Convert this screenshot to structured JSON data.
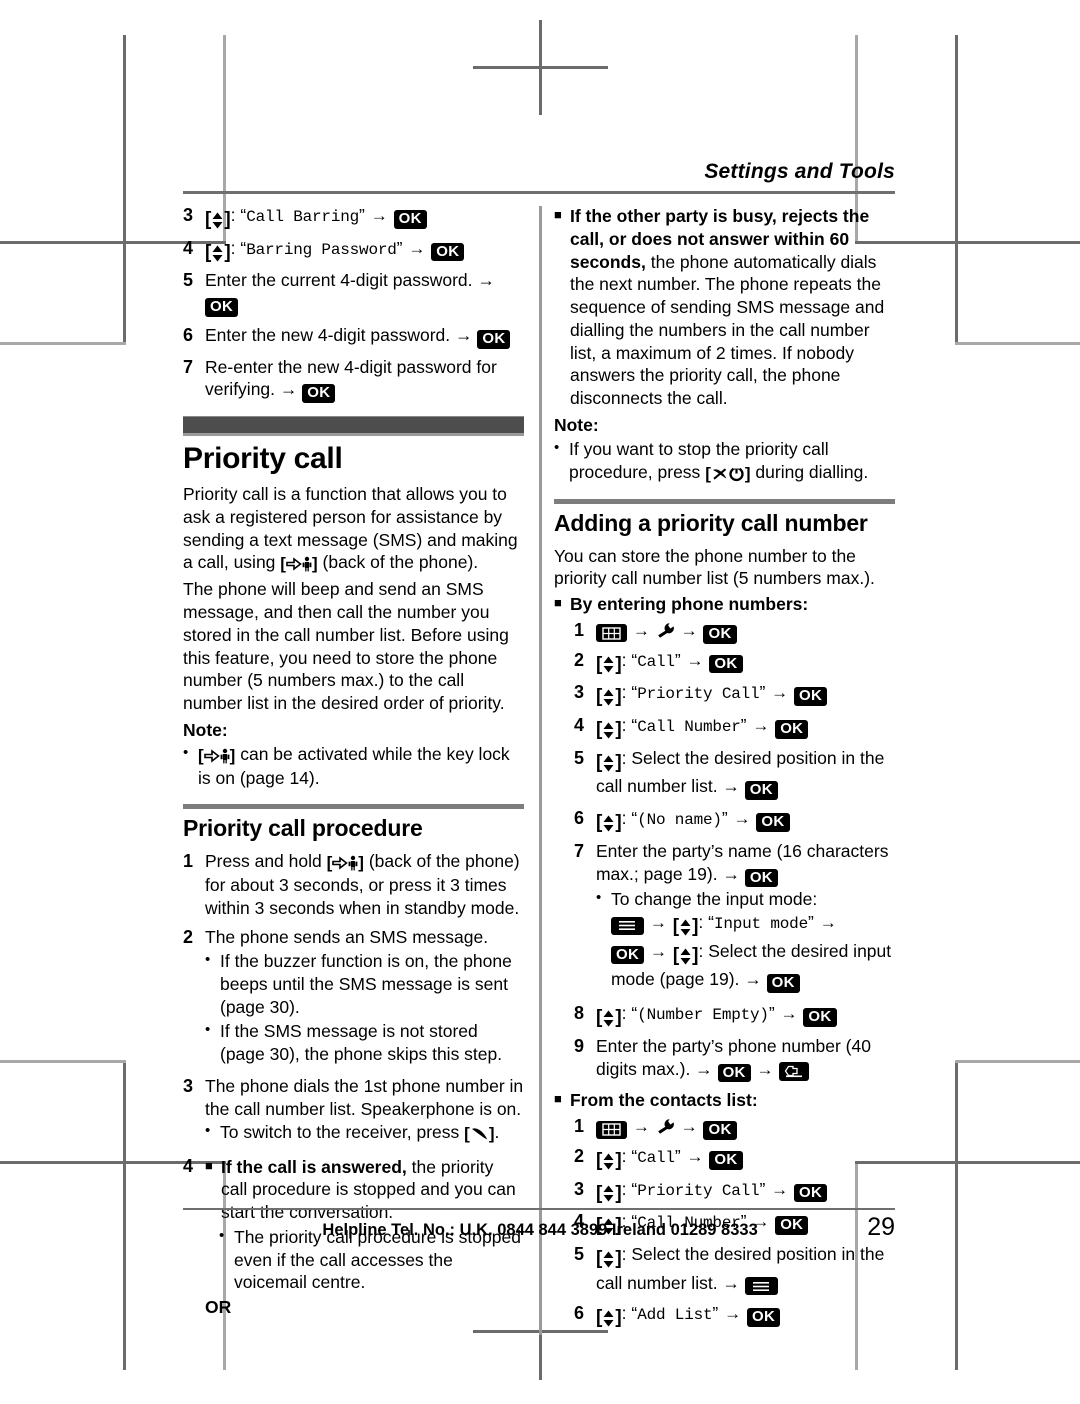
{
  "running_head": "Settings and Tools",
  "left_column": {
    "barring_steps": [
      {
        "num": "3",
        "kind": "nav_mono",
        "quoted": "Call Barring",
        "tail_ok": true
      },
      {
        "num": "4",
        "kind": "nav_mono",
        "quoted": "Barring Password",
        "tail_ok": true
      },
      {
        "num": "5",
        "kind": "text",
        "text": "Enter the current 4-digit password. → OK"
      },
      {
        "num": "6",
        "kind": "text",
        "text": "Enter the new 4-digit password. → OK"
      },
      {
        "num": "7",
        "kind": "text",
        "text": "Re-enter the new 4-digit password for verifying. → OK"
      }
    ],
    "step5_text": "Enter the current 4-digit password. →",
    "step6_text": "Enter the new 4-digit password. →",
    "step7_text": "Re-enter the new 4-digit password for verifying. →",
    "section_title": "Priority call",
    "intro_p1_a": "Priority call is a function that allows you to ask a registered person for assistance by sending a text message (SMS) and making a call, using",
    "intro_p1_b": "(back of the phone).",
    "intro_p2": "The phone will beep and send an SMS message, and then call the number you stored in the call number list. Before using this feature, you need to store the phone number (5 numbers max.) to the call number list in the desired order of priority.",
    "note_label": "Note:",
    "note_bullet_a": "can be activated while the key lock is on (page 14).",
    "procedure_title": "Priority call procedure",
    "proc1_a": "Press and hold",
    "proc1_b": "(back of the phone) for about 3 seconds, or press it 3 times within 3 seconds when in standby mode.",
    "proc2": "The phone sends an SMS message.",
    "proc2_b1": "If the buzzer function is on, the phone beeps until the SMS message is sent (page 30).",
    "proc2_b2": "If the SMS message is not stored (page 30), the phone skips this step.",
    "proc3": "The phone dials the 1st phone number in the call number list. Speakerphone is on.",
    "proc3_b1_a": "To switch to the receiver, press",
    "proc3_b1_b": ".",
    "proc4_bold": "If the call is answered,",
    "proc4_rest": "the priority call procedure is stopped and you can start the conversation.",
    "proc4_b1": "The priority call procedure is stopped even if the call accesses the voicemail centre.",
    "or_label": "OR"
  },
  "right_column": {
    "busy_bold": "If the other party is busy, rejects the call, or does not answer within 60 seconds,",
    "busy_rest": "the phone automatically dials the next number. The phone repeats the sequence of sending SMS message and dialling the numbers in the call number list, a maximum of 2 times. If nobody answers the priority call, the phone disconnects the call.",
    "note_label": "Note:",
    "note_bullet_a": "If you want to stop the priority call procedure, press",
    "note_bullet_b": "during dialling.",
    "adding_title": "Adding a priority call number",
    "adding_intro": "You can store the phone number to the priority call number list (5 numbers max.).",
    "by_entering_label": "By entering phone numbers:",
    "entering_steps": {
      "s1": "",
      "s2_quoted": "Call",
      "s3_quoted": "Priority Call",
      "s4_quoted": "Call Number",
      "s5_text": "Select the desired position in the call number list. →",
      "s6_quoted": "(No name)",
      "s7_a": "Enter the party’s name (16 characters max.; page 19). →",
      "s7_bullet": "To change the input mode:",
      "s7_inputmode_quoted": "Input mode",
      "s7_select": "Select the desired input mode (page 19). →",
      "s8_quoted": "(Number Empty)",
      "s9_a": "Enter the party’s phone number (40 digits max.). →"
    },
    "from_contacts_label": "From the contacts list:",
    "contacts_steps": {
      "s2_quoted": "Call",
      "s3_quoted": "Priority Call",
      "s4_quoted": "Call Number",
      "s5_text": "Select the desired position in the call number list. →",
      "s6_quoted": "Add List"
    }
  },
  "footer": {
    "helpline": "Helpline Tel. No.: U.K. 0844 844 3899 Ireland 01289 8333",
    "page_number": "29"
  },
  "icons": {
    "ok_label": "OK",
    "arrow": "→",
    "nav_key": "nav-updown-key",
    "sos_key": "sos-person-key",
    "talk_key": "talk-handset-key",
    "power_key": "power-offhook-key",
    "grid_key": "menu-grid-key",
    "wrench_key": "settings-wrench-key",
    "menu_key": "soft-menu-key",
    "back_key": "back-return-key",
    "bullet": "•",
    "square": "■"
  }
}
